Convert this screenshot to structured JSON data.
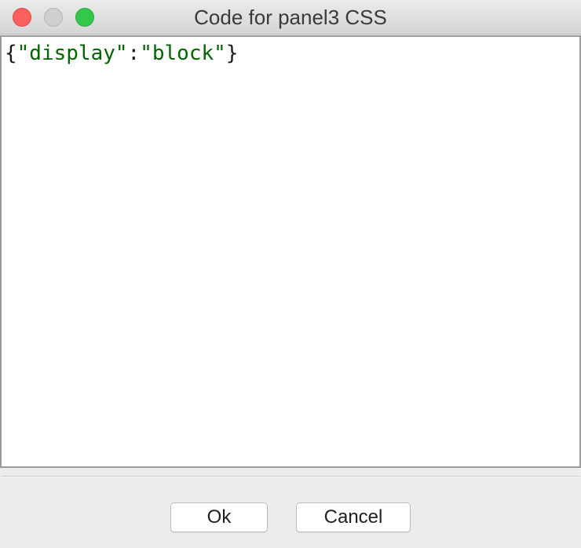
{
  "window": {
    "title": "Code for panel3 CSS"
  },
  "editor": {
    "tokens": [
      {
        "text": "{",
        "kind": "punc"
      },
      {
        "text": "\"display\"",
        "kind": "str"
      },
      {
        "text": ":",
        "kind": "punc"
      },
      {
        "text": "\"block\"",
        "kind": "str"
      },
      {
        "text": "}",
        "kind": "punc"
      }
    ]
  },
  "buttons": {
    "ok_label": "Ok",
    "cancel_label": "Cancel"
  },
  "colors": {
    "string": "#006400",
    "close": "#fc605c",
    "zoom": "#34c84a"
  }
}
